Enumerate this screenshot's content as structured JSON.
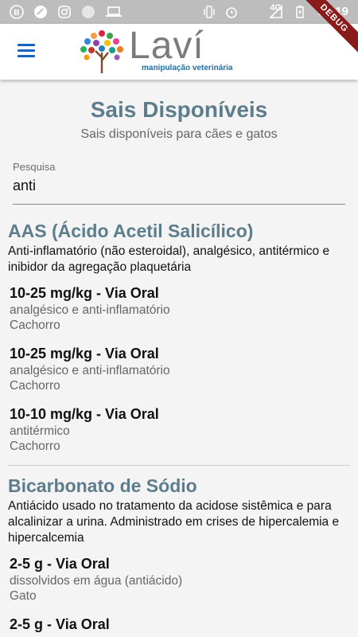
{
  "status_bar": {
    "network": "4G",
    "time": "16:19"
  },
  "debug_ribbon": "DEBUG",
  "header": {
    "logo_word": "Laví",
    "logo_sub": "manipulação veterinária"
  },
  "page": {
    "title": "Sais Disponíveis",
    "subtitle": "Sais disponíveis para cães e gatos"
  },
  "search": {
    "label": "Pesquisa",
    "value": "anti"
  },
  "salts": [
    {
      "name": "AAS (Ácido Acetil Salicílico)",
      "description": "Anti-inflamatório (não esteroidal), analgésico, antitérmico e inibidor da agregação plaquetária",
      "doses": [
        {
          "title": "10-25 mg/kg - Via Oral",
          "use": "analgésico e anti-inflamatório",
          "species": "Cachorro"
        },
        {
          "title": "10-25 mg/kg - Via Oral",
          "use": "analgésico e anti-inflamatório",
          "species": "Cachorro"
        },
        {
          "title": "10-10 mg/kg - Via Oral",
          "use": "antitérmico",
          "species": "Cachorro"
        }
      ]
    },
    {
      "name": "Bicarbonato de Sódio",
      "description": "Antiácido usado no tratamento da acidose sistêmica e para alcalinizar a urina. Administrado em crises de hipercalemia e hipercalcemia",
      "doses": [
        {
          "title": "2-5 g - Via Oral",
          "use": "dissolvidos em água (antiácido)",
          "species": "Gato"
        },
        {
          "title": "2-5 g - Via Oral",
          "use": "",
          "species": ""
        }
      ]
    }
  ]
}
